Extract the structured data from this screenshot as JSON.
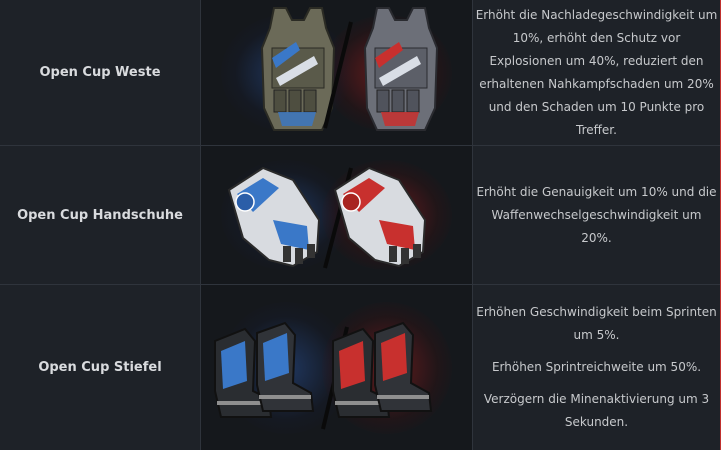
{
  "items": [
    {
      "name": "Open Cup Weste",
      "description": [
        "Erhöht die Nachladegeschwindigkeit um 10%, erhöht den Schutz vor Explosionen um 40%, reduziert den erhaltenen Nahkampfschaden um 20% und den Schaden um 10 Punkte pro Treffer."
      ],
      "icon": "vest-icon"
    },
    {
      "name": "Open Cup Handschuhe",
      "description": [
        "Erhöht die Genauigkeit um 10% und die Waffenwechselgeschwindigkeit um 20%."
      ],
      "icon": "gloves-icon"
    },
    {
      "name": "Open Cup Stiefel",
      "description": [
        "Erhöhen Geschwindigkeit beim Sprinten um 5%.",
        "Erhöhen Sprintreichweite um 50%.",
        "Verzögern die Minenaktivierung um 3 Sekunden."
      ],
      "icon": "boots-icon"
    }
  ],
  "colors": {
    "background": "#1e2228",
    "blue_variant": "#3a78c8",
    "red_variant": "#c8302e",
    "text": "#c7c9cc"
  }
}
